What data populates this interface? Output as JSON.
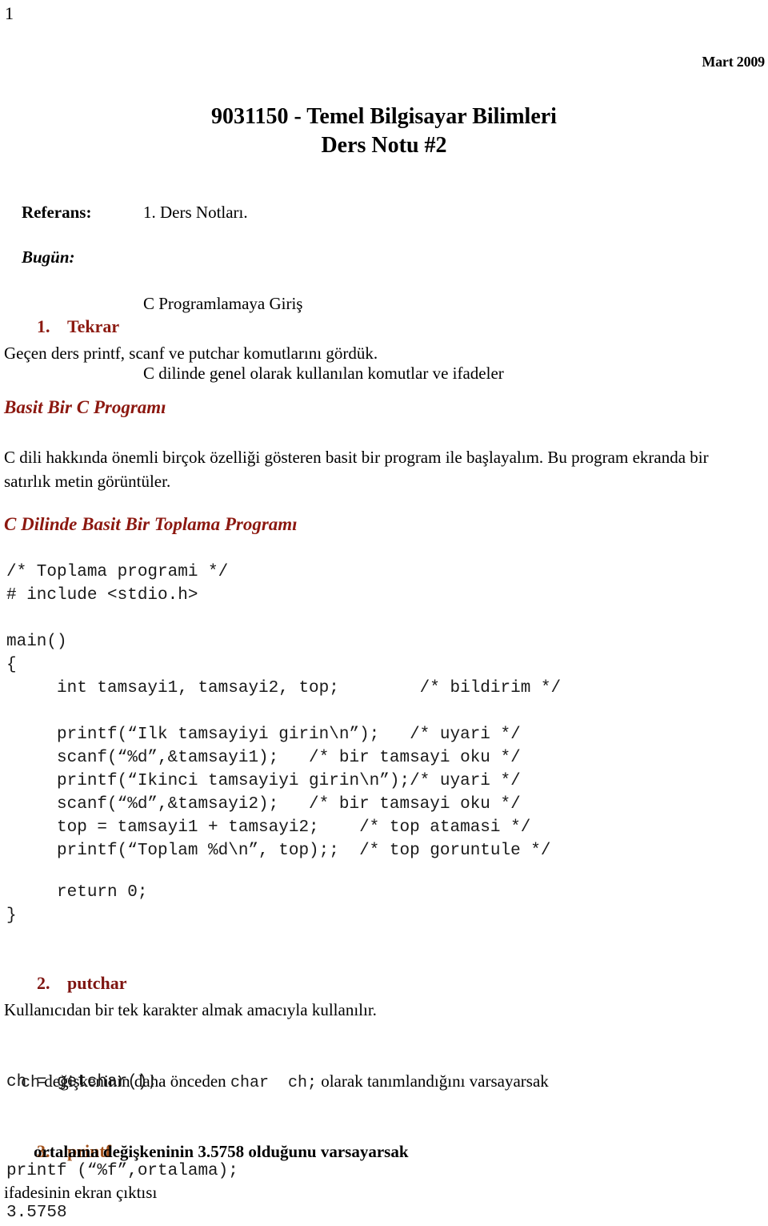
{
  "document": {
    "page_number": "1",
    "date_stamp": "Mart 2009",
    "title_line1": "9031150 - Temel Bilgisayar Bilimleri",
    "title_line2": "Ders Notu  #2"
  },
  "meta": {
    "referans": {
      "label": "Referans:",
      "value": "1. Ders Notları."
    },
    "bugun": {
      "label": "Bugün:",
      "value_line1": "C Programlamaya Giriş",
      "value_line2": "C dilinde genel olarak kullanılan komutlar ve ifadeler"
    }
  },
  "sections": {
    "tekrar": {
      "number": "1.",
      "title": "Tekrar",
      "color": "#8C1A11",
      "paragraph": "Geçen ders printf, scanf ve putchar komutlarını gördük."
    },
    "basit_program": {
      "heading": "Basit Bir C Programı",
      "color": "#8C1810",
      "paragraph": "C dili hakkında önemli birçok özelliği gösteren basit bir program ile başlayalım. Bu program ekranda bir satırlık metin görüntüler."
    },
    "toplama": {
      "heading": "C Dilinde Basit Bir Toplama Programı",
      "color": "#8C1810",
      "code": "/* Toplama programi */\n# include <stdio.h>\n\nmain()\n{\n     int tamsayi1, tamsayi2, top;        /* bildirim */\n\n     printf(“Ilk tamsayiyi girin\\n”);   /* uyari */\n     scanf(“%d”,&tamsayi1);   /* bir tamsayi oku */\n     printf(“Ikinci tamsayiyi girin\\n”);/* uyari */\n     scanf(“%d”,&tamsayi2);   /* bir tamsayi oku */\n     top = tamsayi1 + tamsayi2;    /* top atamasi */\n     printf(“Toplam %d\\n”, top);;  /* top goruntule */",
      "code_tail": "     return 0;\n}"
    },
    "putchar": {
      "number": "2.",
      "title": "putchar",
      "color": "#7E1410",
      "paragraph": "Kullanıcıdan bir tek karakter almak amacıyla kullanılır.",
      "mixed_line": {
        "part1_mono": "ch",
        "part2_text": " değişkeninin daha önceden ",
        "part3_mono": "char  ch;",
        "part4_text": " olarak tanımlandığını varsayarsak"
      },
      "code": "ch = getchar();"
    },
    "printf": {
      "number": "3.",
      "title": "printf",
      "color": "#A3521C",
      "subline": "ortalama değişkeninin 3.5758 olduğunu varsayarsak",
      "code": "printf (“%f”,ortalama);",
      "paragraph": "ifadesinin ekran çıktısı",
      "output": "3.5758"
    }
  }
}
